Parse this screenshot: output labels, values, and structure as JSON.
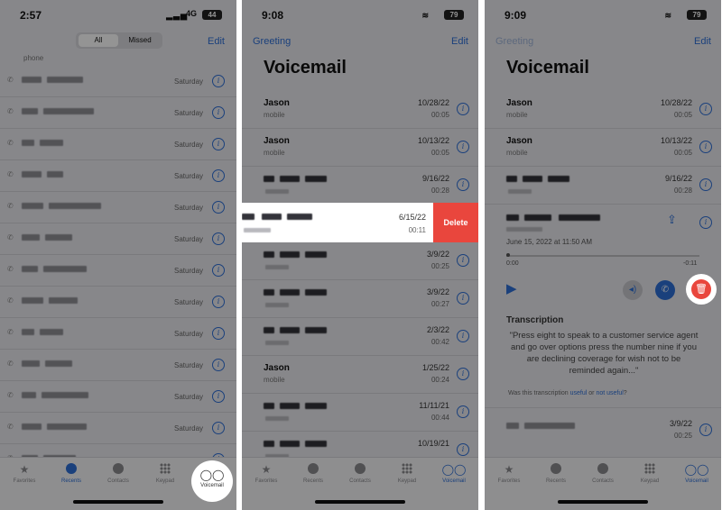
{
  "phone1": {
    "time": "2:57",
    "network": "4G",
    "battery": "44",
    "segments": [
      "All",
      "Missed"
    ],
    "edit": "Edit",
    "partial_text": "phone",
    "day_label": "Saturday",
    "row_count": 13
  },
  "phone2": {
    "time": "9:08",
    "battery": "79",
    "greeting": "Greeting",
    "edit": "Edit",
    "title": "Voicemail",
    "voicemails": [
      {
        "name": "Jason",
        "sub": "mobile",
        "date": "10/28/22",
        "duration": "00:05"
      },
      {
        "name": "Jason",
        "sub": "mobile",
        "date": "10/13/22",
        "duration": "00:05"
      },
      {
        "name": "",
        "sub": "",
        "date": "9/16/22",
        "duration": "00:28"
      },
      {
        "name": "",
        "sub": "",
        "date": "6/15/22",
        "duration": "00:11",
        "highlighted": true
      },
      {
        "name": "",
        "sub": "",
        "date": "3/9/22",
        "duration": "00:25"
      },
      {
        "name": "",
        "sub": "",
        "date": "3/9/22",
        "duration": "00:27"
      },
      {
        "name": "",
        "sub": "",
        "date": "2/3/22",
        "duration": "00:42"
      },
      {
        "name": "Jason",
        "sub": "mobile",
        "date": "1/25/22",
        "duration": "00:24"
      },
      {
        "name": "",
        "sub": "",
        "date": "11/11/21",
        "duration": "00:44"
      },
      {
        "name": "",
        "sub": "",
        "date": "10/19/21",
        "duration": ""
      }
    ],
    "delete_label": "Delete"
  },
  "phone3": {
    "time": "9:09",
    "battery": "79",
    "greeting": "Greeting",
    "edit": "Edit",
    "title": "Voicemail",
    "voicemails": [
      {
        "name": "Jason",
        "sub": "mobile",
        "date": "10/28/22",
        "duration": "00:05"
      },
      {
        "name": "Jason",
        "sub": "mobile",
        "date": "10/13/22",
        "duration": "00:05"
      },
      {
        "name": "",
        "sub": "",
        "date": "9/16/22",
        "duration": "00:28"
      }
    ],
    "detail": {
      "date_line": "June 15, 2022 at 11:50 AM",
      "elapsed": "0:00",
      "remaining": "-0:11",
      "transcription_heading": "Transcription",
      "transcription": "\"Press eight to speak to a customer service agent and go over options press the number nine if you are declining coverage for wish not to be reminded again...\"",
      "feedback_prefix": "Was this transcription",
      "useful": "useful",
      "or": "or",
      "not_useful": "not useful",
      "question_mark": "?"
    },
    "below": {
      "date": "3/9/22",
      "duration": "00:25"
    }
  },
  "tabs": [
    {
      "label": "Favorites",
      "icon": "star-icon"
    },
    {
      "label": "Recents",
      "icon": "clock-icon"
    },
    {
      "label": "Contacts",
      "icon": "person-icon"
    },
    {
      "label": "Keypad",
      "icon": "keypad-icon"
    },
    {
      "label": "Voicemail",
      "icon": "voicemail-icon"
    }
  ],
  "colors": {
    "accent": "#2e6fd6",
    "delete": "#e9463d"
  }
}
